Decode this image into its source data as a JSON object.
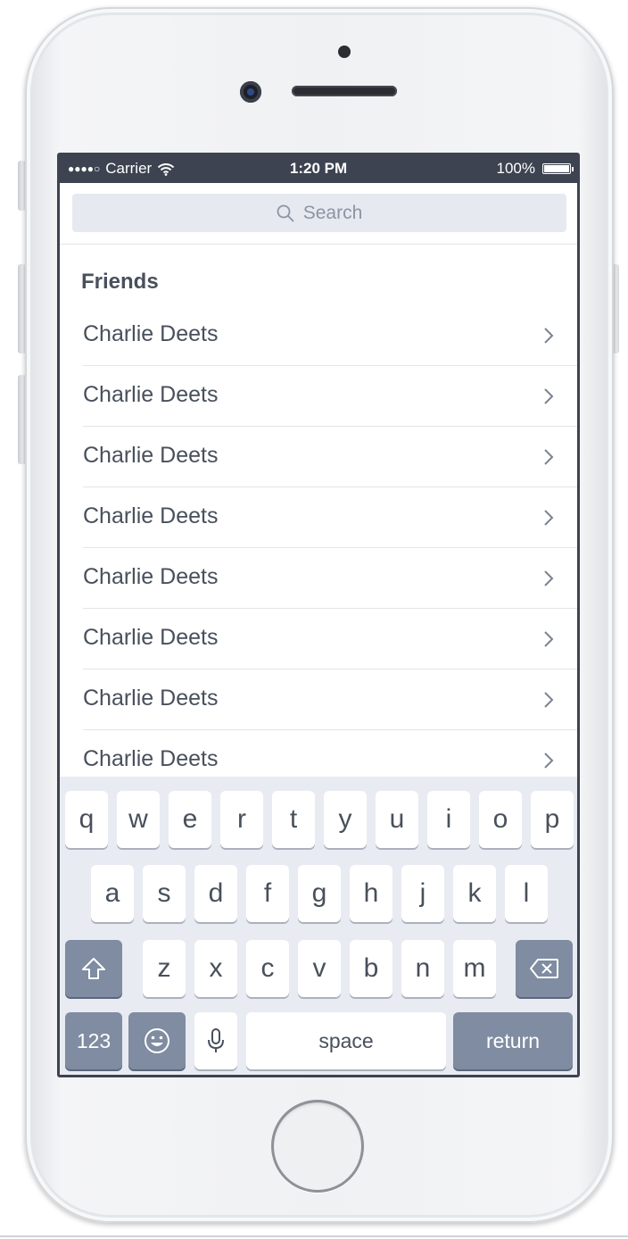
{
  "status_bar": {
    "signal": "●●●●○",
    "carrier": "Carrier",
    "time": "1:20 PM",
    "battery": "100%"
  },
  "search": {
    "placeholder": "Search"
  },
  "section": {
    "title": "Friends"
  },
  "friends": [
    {
      "name": "Charlie Deets"
    },
    {
      "name": "Charlie Deets"
    },
    {
      "name": "Charlie Deets"
    },
    {
      "name": "Charlie Deets"
    },
    {
      "name": "Charlie Deets"
    },
    {
      "name": "Charlie Deets"
    },
    {
      "name": "Charlie Deets"
    },
    {
      "name": "Charlie Deets"
    }
  ],
  "keyboard": {
    "row1": [
      "q",
      "w",
      "e",
      "r",
      "t",
      "y",
      "u",
      "i",
      "o",
      "p"
    ],
    "row2": [
      "a",
      "s",
      "d",
      "f",
      "g",
      "h",
      "j",
      "k",
      "l"
    ],
    "row3": [
      "z",
      "x",
      "c",
      "v",
      "b",
      "n",
      "m"
    ],
    "numbers_label": "123",
    "space_label": "space",
    "return_label": "return",
    "shift_icon": "shift-icon",
    "delete_icon": "delete-icon",
    "emoji_icon": "emoji-icon",
    "mic_icon": "microphone-icon"
  },
  "colors": {
    "screen_frame": "#3d4350",
    "text": "#48505c",
    "keyboard_bg": "#e8ebf2",
    "dark_key": "#7f8ca1",
    "search_bg": "#e6e9f0"
  }
}
